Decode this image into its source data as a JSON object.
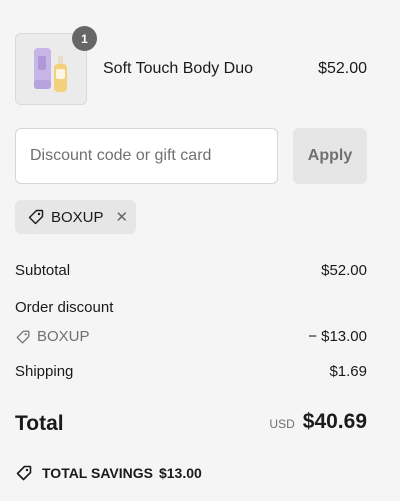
{
  "product": {
    "name": "Soft Touch Body Duo",
    "price": "$52.00",
    "quantity": "1"
  },
  "discount": {
    "placeholder": "Discount code or gift card",
    "value": "",
    "apply_label": "Apply",
    "applied_code": "BOXUP"
  },
  "summary": {
    "subtotal_label": "Subtotal",
    "subtotal_value": "$52.00",
    "order_discount_label": "Order discount",
    "discount_code": "BOXUP",
    "discount_value": "− $13.00",
    "shipping_label": "Shipping",
    "shipping_value": "$1.69",
    "total_label": "Total",
    "currency": "USD",
    "total_value": "$40.69",
    "savings_label": "TOTAL SAVINGS",
    "savings_value": "$13.00"
  },
  "icons": {
    "tag": "tag-icon",
    "remove": "close-icon"
  }
}
